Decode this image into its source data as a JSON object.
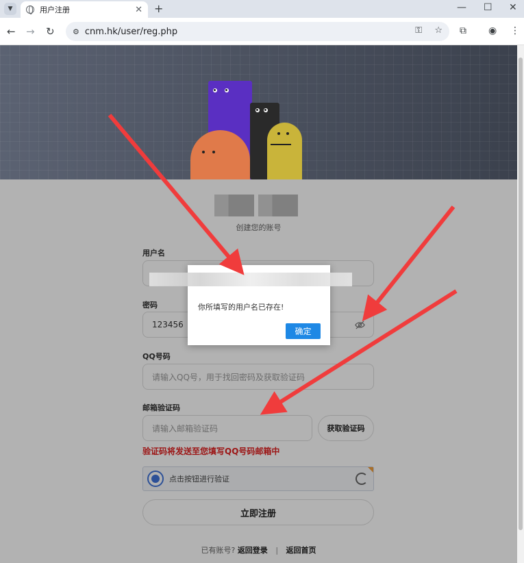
{
  "browser": {
    "tab_title": "用户注册",
    "tab_close": "✕",
    "new_tab": "+",
    "url": "cnm.hk/user/reg.php",
    "minimize": "—",
    "maximize": "☐",
    "close": "✕"
  },
  "page": {
    "subtitle": "创建您的账号",
    "username_label": "用户名",
    "password_label": "密码",
    "password_value": "123456",
    "qq_label": "QQ号码",
    "qq_placeholder": "请输入QQ号，用于找回密码及获取验证码",
    "email_code_label": "邮箱验证码",
    "email_code_placeholder": "请输入邮箱验证码",
    "get_code_button": "获取验证码",
    "notice": "验证码将发送至您填写QQ号码邮箱中",
    "captcha_text": "点击按钮进行验证",
    "submit_button": "立即注册",
    "footer_prefix": "已有账号?",
    "login_link": "返回登录",
    "footer_sep": "|",
    "home_link": "返回首页"
  },
  "dialog": {
    "message": "你所填写的用户名已存在!",
    "ok_button": "确定"
  },
  "colors": {
    "accent": "#1e88e5",
    "notice": "#e02020",
    "arrow": "#f03c3c",
    "char_purple": "#5a2fc2",
    "char_black": "#2a2a2a",
    "char_orange": "#e07a4a",
    "char_yellow": "#c9b43a"
  }
}
